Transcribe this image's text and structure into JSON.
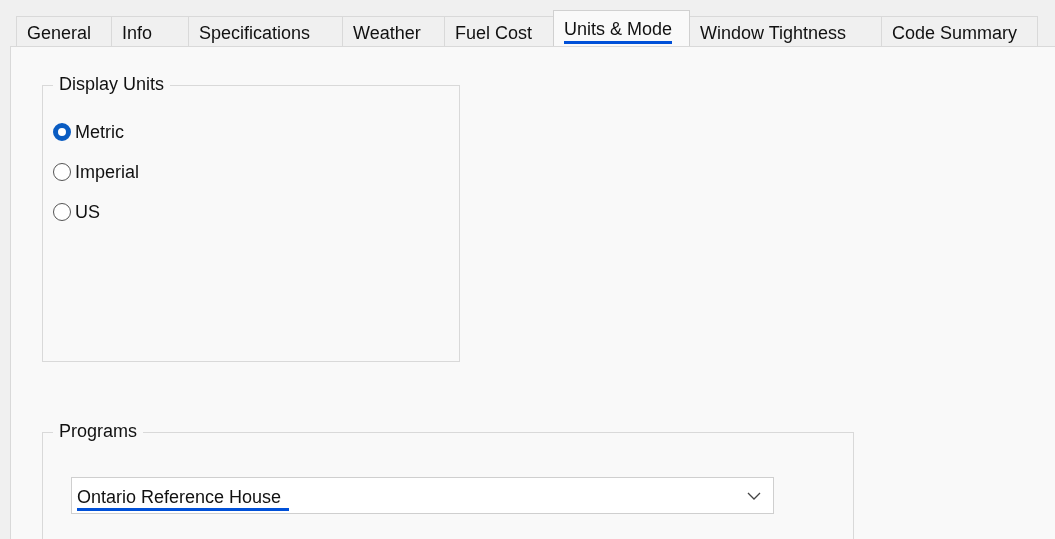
{
  "tabs": [
    {
      "label": "General",
      "selected": false
    },
    {
      "label": "Info",
      "selected": false
    },
    {
      "label": "Specifications",
      "selected": false
    },
    {
      "label": "Weather",
      "selected": false
    },
    {
      "label": "Fuel Cost",
      "selected": false
    },
    {
      "label": "Units & Mode",
      "selected": true
    },
    {
      "label": "Window Tightness",
      "selected": false
    },
    {
      "label": "Code Summary",
      "selected": false
    }
  ],
  "display_units": {
    "title": "Display Units",
    "options": [
      {
        "label": "Metric",
        "selected": true
      },
      {
        "label": "Imperial",
        "selected": false
      },
      {
        "label": "US",
        "selected": false
      }
    ]
  },
  "programs": {
    "title": "Programs",
    "dropdown": {
      "value": "Ontario Reference House"
    }
  }
}
